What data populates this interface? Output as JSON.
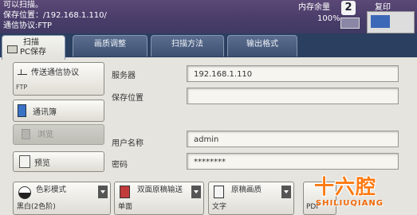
{
  "status": {
    "line1": "可以扫描。",
    "line2": "保存位置：/192.168.1.110/",
    "line3": "通信协议:FTP",
    "memory_label": "内存余量",
    "memory_value": "100%",
    "mode_icon_number": "2",
    "mode_label": "复印"
  },
  "tabs": [
    {
      "line1": "扫描",
      "line2": "PC保存"
    },
    {
      "label": "画质调整"
    },
    {
      "label": "扫描方法"
    },
    {
      "label": "输出格式"
    }
  ],
  "left": {
    "method_label": "传送通信协议",
    "method_value": "FTP",
    "address_book": "通讯簿",
    "browse": "浏览",
    "preview": "预览"
  },
  "fields": {
    "server_label": "服务器",
    "server_value": "192.168.1.110",
    "location_label": "保存位置",
    "location_value": "",
    "username_label": "用户名称",
    "username_value": "admin",
    "password_label": "密码",
    "password_value": "********"
  },
  "settings": [
    {
      "name": "色彩模式",
      "value": "黑白(2色阶)"
    },
    {
      "name": "双面原稿输送",
      "value": "单面"
    },
    {
      "name": "原稿画质",
      "value": "文字"
    },
    {
      "name": "",
      "value": "PDF"
    }
  ],
  "watermark": {
    "main": "十六腔",
    "sub": "SHILIUQIANG"
  }
}
